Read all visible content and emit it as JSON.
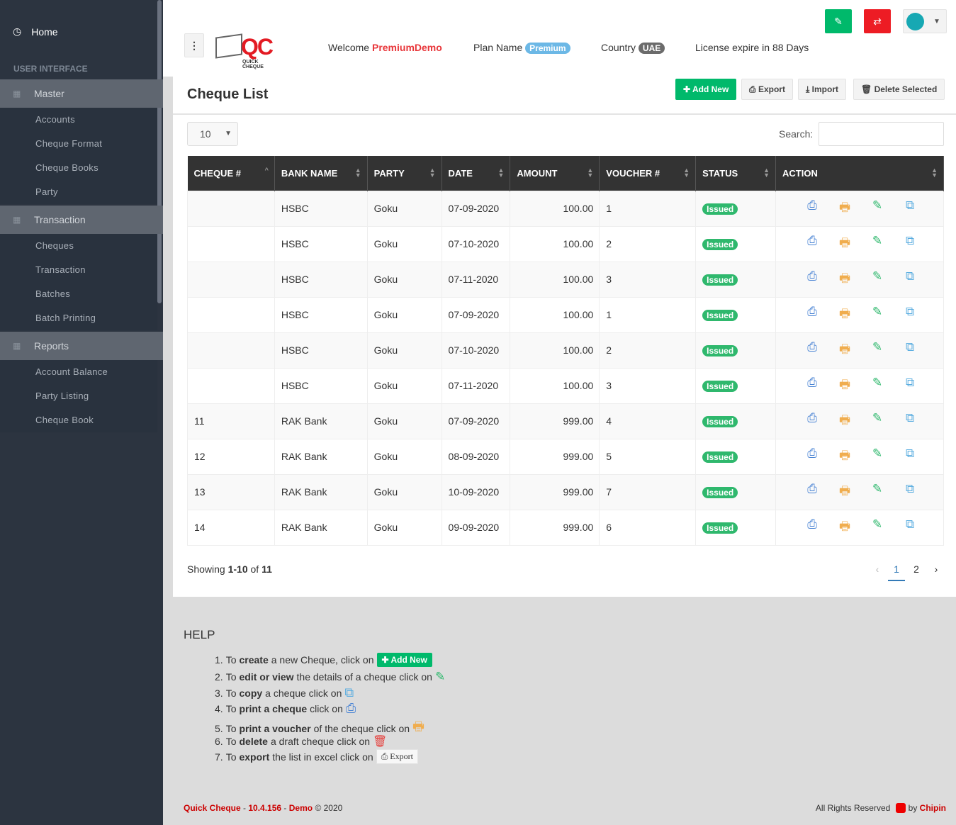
{
  "sidebar": {
    "home": "Home",
    "section_header": "USER INTERFACE",
    "sections": [
      {
        "label": "Master",
        "icon": "sitemap-icon",
        "items": [
          "Accounts",
          "Cheque Format",
          "Cheque Books",
          "Party"
        ]
      },
      {
        "label": "Transaction",
        "icon": "leaf-icon",
        "items": [
          "Cheques",
          "Transaction",
          "Batches",
          "Batch Printing"
        ]
      },
      {
        "label": "Reports",
        "icon": "book-icon",
        "items": [
          "Account Balance",
          "Party Listing",
          "Cheque Book"
        ]
      }
    ]
  },
  "header": {
    "logo_text": "QC",
    "logo_sub": "QUICK CHEQUE",
    "welcome_label": "Welcome",
    "username": "PremiumDemo",
    "plan_label": "Plan Name",
    "plan": "Premium",
    "country_label": "Country",
    "country": "UAE",
    "license": "License expire in 88 Days",
    "colors": {
      "green": "#00b96b",
      "red": "#ed1c24",
      "plan": "#6cb8e6",
      "country": "#6b6b6b"
    }
  },
  "page": {
    "title": "Cheque List",
    "buttons": {
      "add": "Add New",
      "export": "Export",
      "import": "Import",
      "delete": "Delete Selected"
    },
    "page_size": "10",
    "search_label": "Search:",
    "search_value": "",
    "columns": [
      "CHEQUE #",
      "BANK NAME",
      "PARTY",
      "DATE",
      "AMOUNT",
      "VOUCHER #",
      "STATUS",
      "ACTION"
    ],
    "rows": [
      [
        "",
        "HSBC",
        "Goku",
        "07-09-2020",
        "100.00",
        "1",
        "Issued"
      ],
      [
        "",
        "HSBC",
        "Goku",
        "07-10-2020",
        "100.00",
        "2",
        "Issued"
      ],
      [
        "",
        "HSBC",
        "Goku",
        "07-11-2020",
        "100.00",
        "3",
        "Issued"
      ],
      [
        "",
        "HSBC",
        "Goku",
        "07-09-2020",
        "100.00",
        "1",
        "Issued"
      ],
      [
        "",
        "HSBC",
        "Goku",
        "07-10-2020",
        "100.00",
        "2",
        "Issued"
      ],
      [
        "",
        "HSBC",
        "Goku",
        "07-11-2020",
        "100.00",
        "3",
        "Issued"
      ],
      [
        "11",
        "RAK Bank",
        "Goku",
        "07-09-2020",
        "999.00",
        "4",
        "Issued"
      ],
      [
        "12",
        "RAK Bank",
        "Goku",
        "08-09-2020",
        "999.00",
        "5",
        "Issued"
      ],
      [
        "13",
        "RAK Bank",
        "Goku",
        "10-09-2020",
        "999.00",
        "7",
        "Issued"
      ],
      [
        "14",
        "RAK Bank",
        "Goku",
        "09-09-2020",
        "999.00",
        "6",
        "Issued"
      ]
    ],
    "showing": {
      "prefix": "Showing",
      "range": "1-10",
      "of": "of",
      "total": "11"
    },
    "pagination": {
      "prev": "‹",
      "pages": [
        "1",
        "2"
      ],
      "current": "1",
      "next": "›"
    }
  },
  "help": {
    "title": "HELP",
    "items": [
      {
        "n": "1.",
        "pre": "To",
        "bold": "create",
        "post": "a new Cheque, click on"
      },
      {
        "n": "2.",
        "pre": "To",
        "bold": "edit or view",
        "post": "the details of a cheque click on"
      },
      {
        "n": "3.",
        "pre": "To",
        "bold": "copy",
        "post": "a cheque click on"
      },
      {
        "n": "4.",
        "pre": "To",
        "bold": "print a cheque",
        "post": "click on"
      },
      {
        "n": "5.",
        "pre": "To",
        "bold": "print a voucher",
        "post": "of the cheque click on"
      },
      {
        "n": "6.",
        "pre": "To",
        "bold": "delete",
        "post": "a draft cheque click on"
      },
      {
        "n": "7.",
        "pre": "To",
        "bold": "export",
        "post": "the list in excel click on"
      }
    ]
  },
  "footer": {
    "app": "Quick Cheque",
    "version": "10.4.156",
    "edition": "Demo",
    "copy": "© 2020",
    "rights": "All Rights Reserved",
    "by": "by",
    "company": "Chipin"
  }
}
